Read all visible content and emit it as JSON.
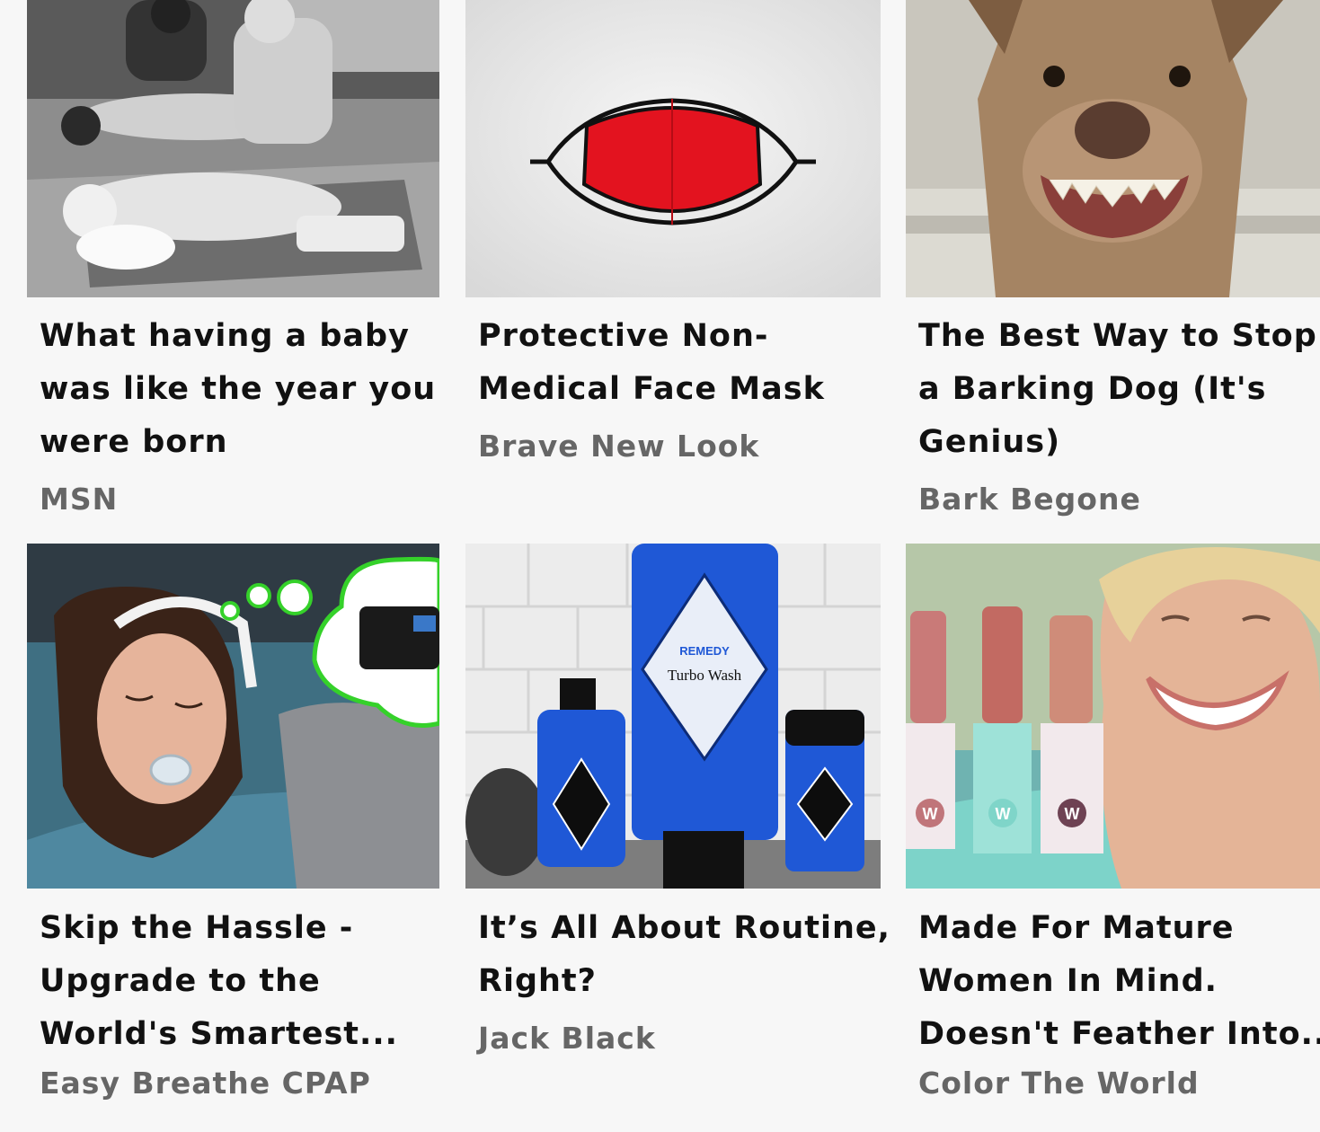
{
  "feed": {
    "cards": [
      {
        "title_lines": [
          "What having a baby",
          "was like the year you",
          "were born"
        ],
        "source": "MSN",
        "image": "vintage-maternity-class-photo"
      },
      {
        "title_lines": [
          "Protective Non-",
          "Medical Face Mask"
        ],
        "source": "Brave New Look",
        "image": "red-face-mask-photo"
      },
      {
        "title_lines": [
          "The Best Way to Stop",
          "a Barking Dog (It's",
          "Genius)"
        ],
        "source": "Bark Begone",
        "image": "smiling-dog-photo"
      },
      {
        "title_lines": [
          "Skip the Hassle -",
          "Upgrade to the",
          "World's Smartest..."
        ],
        "source": "Easy Breathe CPAP",
        "image": "sleeping-woman-cpap-photo"
      },
      {
        "title_lines": [
          "It’s All About Routine,",
          "Right?"
        ],
        "source": "Jack Black",
        "image": "skincare-products-photo",
        "product_text": [
          "REMEDY",
          "Turbo Wash"
        ]
      },
      {
        "title_lines": [
          "Made For Mature",
          "Women In Mind.",
          "Doesn't Feather Into..."
        ],
        "source": "Color The World",
        "image": "lipstick-woman-photo",
        "product_text": [
          "W",
          "W",
          "W"
        ]
      }
    ]
  },
  "colors": {
    "background": "#f7f7f7",
    "title": "#111111",
    "source": "#666666",
    "mask_red": "#e3131f",
    "cpap_green": "#35d12a",
    "jack_black_blue": "#1f58d6"
  }
}
